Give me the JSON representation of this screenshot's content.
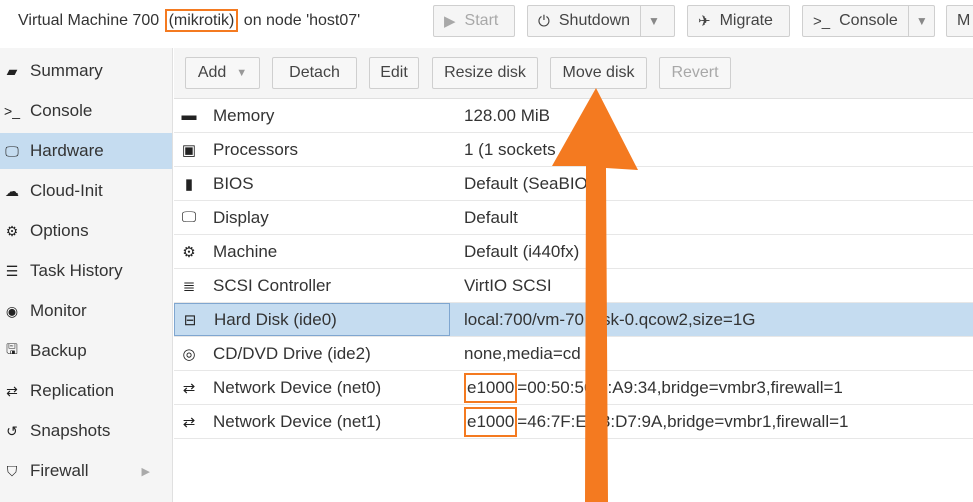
{
  "header": {
    "title_pre": "Virtual Machine 700 ",
    "title_name": "(mikrotik)",
    "title_post": " on node 'host07'",
    "buttons": {
      "start": "Start",
      "shutdown": "Shutdown",
      "migrate": "Migrate",
      "console": "Console",
      "more": "M"
    }
  },
  "sidebar": {
    "items": [
      {
        "label": "Summary",
        "icon": "book-icon"
      },
      {
        "label": "Console",
        "icon": "terminal-icon"
      },
      {
        "label": "Hardware",
        "icon": "desktop-icon"
      },
      {
        "label": "Cloud-Init",
        "icon": "cloud-icon"
      },
      {
        "label": "Options",
        "icon": "gear-icon"
      },
      {
        "label": "Task History",
        "icon": "list-icon"
      },
      {
        "label": "Monitor",
        "icon": "eye-icon"
      },
      {
        "label": "Backup",
        "icon": "floppy-icon"
      },
      {
        "label": "Replication",
        "icon": "retweet-icon"
      },
      {
        "label": "Snapshots",
        "icon": "history-icon"
      },
      {
        "label": "Firewall",
        "icon": "shield-icon"
      }
    ],
    "active": "Hardware"
  },
  "toolbar": {
    "add": "Add",
    "detach": "Detach",
    "edit": "Edit",
    "resize": "Resize disk",
    "move": "Move disk",
    "revert": "Revert"
  },
  "hardware": [
    {
      "name": "Memory",
      "value": "128.00 MiB",
      "icon": "memory-icon"
    },
    {
      "name": "Processors",
      "value": "1 (1 sockets",
      "icon": "cpu-icon"
    },
    {
      "name": "BIOS",
      "value": "Default (SeaBIO",
      "icon": "microchip-icon"
    },
    {
      "name": "Display",
      "value": "Default",
      "icon": "monitor-icon"
    },
    {
      "name": "Machine",
      "value": "Default (i440fx)",
      "icon": "cogs-icon"
    },
    {
      "name": "SCSI Controller",
      "value": "VirtIO SCSI",
      "icon": "database-icon"
    },
    {
      "name": "Hard Disk (ide0)",
      "value": "local:700/vm-70 disk-0.qcow2,size=1G",
      "icon": "hdd-icon"
    },
    {
      "name": "CD/DVD Drive (ide2)",
      "value": "none,media=cd m",
      "icon": "cdrom-icon"
    },
    {
      "name": "Network Device (net0)",
      "value_model": "e1000",
      "value": "=00:50:56 0:A9:34,bridge=vmbr3,firewall=1",
      "icon": "exchange-icon"
    },
    {
      "name": "Network Device (net1)",
      "value_model": "e1000",
      "value": "=46:7F:E4 3:D7:9A,bridge=vmbr1,firewall=1",
      "icon": "exchange-icon"
    }
  ],
  "annotation_color": "#f47a20",
  "selection_color": "#c5dcf0"
}
